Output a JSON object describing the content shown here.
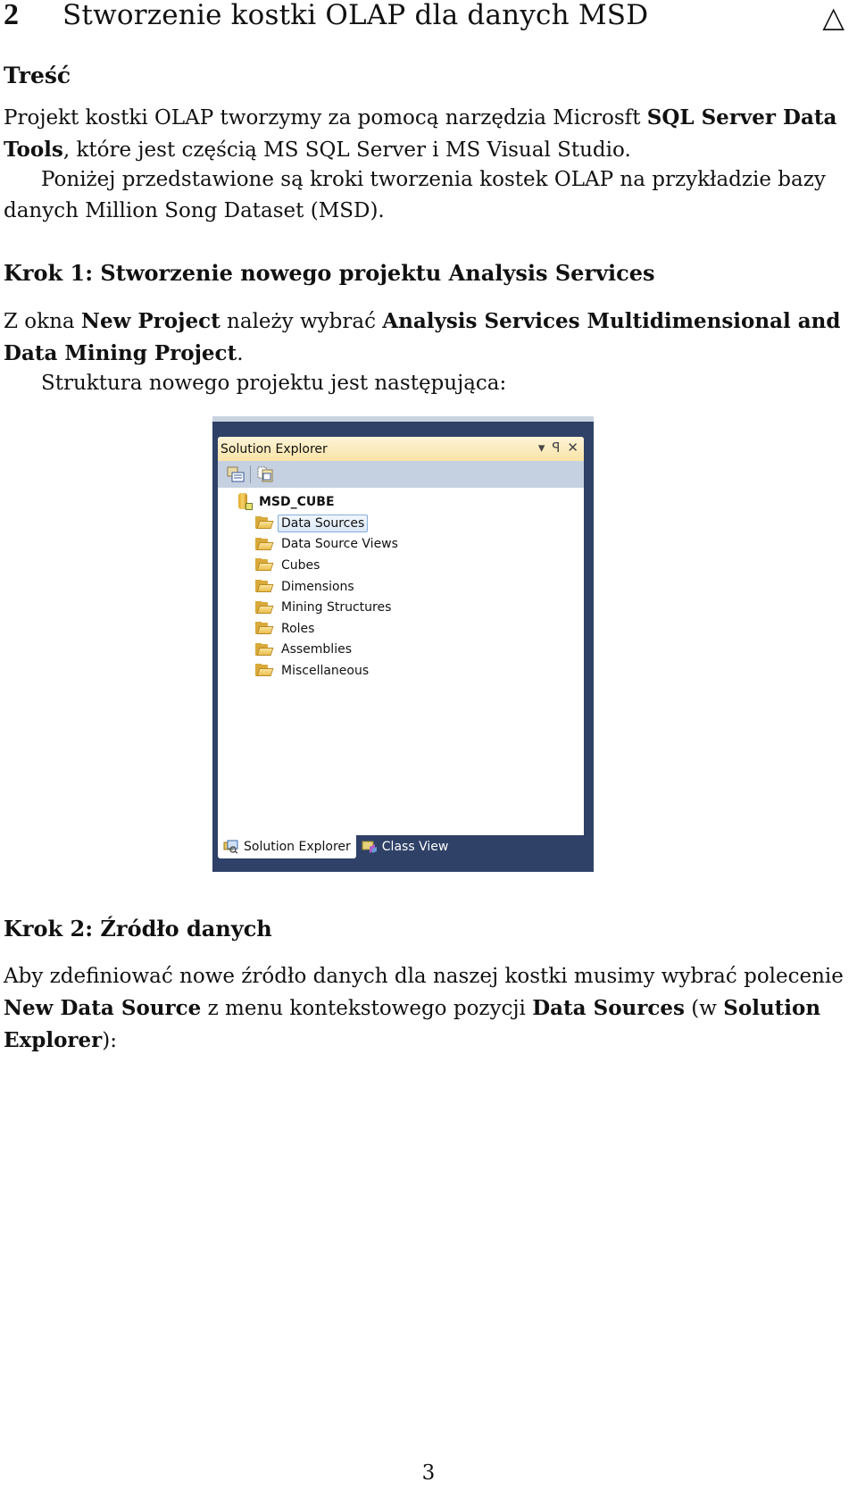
{
  "section": {
    "number": "2",
    "title": "Stworzenie kostki OLAP dla danych MSD",
    "marker_icon": "triangle-outline-icon"
  },
  "subtitle": "Treść",
  "intro": {
    "p1_a": "Projekt kostki OLAP tworzymy za pomocą narzędzia Microsft ",
    "p1_bold": "SQL Server Data Tools",
    "p1_b": ", które jest częścią MS SQL Server i MS Visual Studio.",
    "p2": "Poniżej przedstawione są kroki tworzenia kostek OLAP na przykładzie bazy danych Million Song Dataset (MSD)."
  },
  "step1": {
    "heading": "Krok 1: Stworzenie nowego projektu Analysis Services",
    "p1_a": "Z okna ",
    "p1_bold1": "New Project",
    "p1_b": " należy wybrać ",
    "p1_bold2": "Analysis Services Multidimensional and Data Mining Project",
    "p1_c": ".",
    "p2": "Struktura nowego projektu jest następująca:"
  },
  "solution_explorer": {
    "title": "Solution Explorer",
    "controls": {
      "dropdown": "▾",
      "pin": "ꟼ",
      "close": "✕"
    },
    "toolbar_icons": [
      "properties-icon",
      "show-all-files-icon"
    ],
    "project": "MSD_CUBE",
    "items": [
      {
        "label": "Data Sources",
        "selected": true
      },
      {
        "label": "Data Source Views",
        "selected": false
      },
      {
        "label": "Cubes",
        "selected": false
      },
      {
        "label": "Dimensions",
        "selected": false
      },
      {
        "label": "Mining Structures",
        "selected": false
      },
      {
        "label": "Roles",
        "selected": false
      },
      {
        "label": "Assemblies",
        "selected": false
      },
      {
        "label": "Miscellaneous",
        "selected": false
      }
    ],
    "tabs": [
      {
        "label": "Solution Explorer",
        "active": true
      },
      {
        "label": "Class View",
        "active": false
      }
    ]
  },
  "step2": {
    "heading": "Krok 2: Źródło danych",
    "p1_a": "Aby zdefiniować nowe źródło danych dla naszej kostki musimy wybrać polecenie ",
    "p1_bold1": "New Data Source",
    "p1_b": " z menu kontekstowego pozycji ",
    "p1_bold2": "Data Sources",
    "p1_c": " (w ",
    "p1_bold3": "Solution Explorer",
    "p1_d": "):"
  },
  "page_number": "3"
}
